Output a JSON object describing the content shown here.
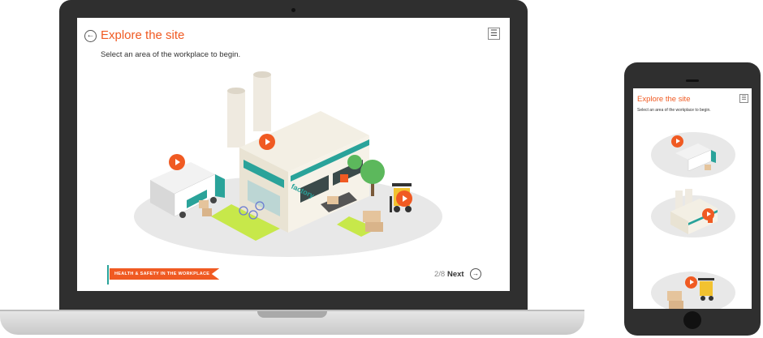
{
  "laptop": {
    "title": "Explore the site",
    "subtitle": "Select an area of the workplace to begin.",
    "back_icon": "arrow-left-icon",
    "menu_icon": "hamburger-menu-icon",
    "banner": "HEALTH & SAFETY IN THE WORKPLACE",
    "pagination": "2/8",
    "next_label": "Next",
    "next_icon": "arrow-right-icon",
    "factory_sign": "factory"
  },
  "phone": {
    "title": "Explore the site",
    "subtitle": "Select an area of the workplace to begin.",
    "menu_icon": "hamburger-menu-icon"
  },
  "colors": {
    "accent": "#f05a22",
    "teal": "#2aa39a",
    "device": "#2f2f2f",
    "lime": "#c7e84a"
  }
}
